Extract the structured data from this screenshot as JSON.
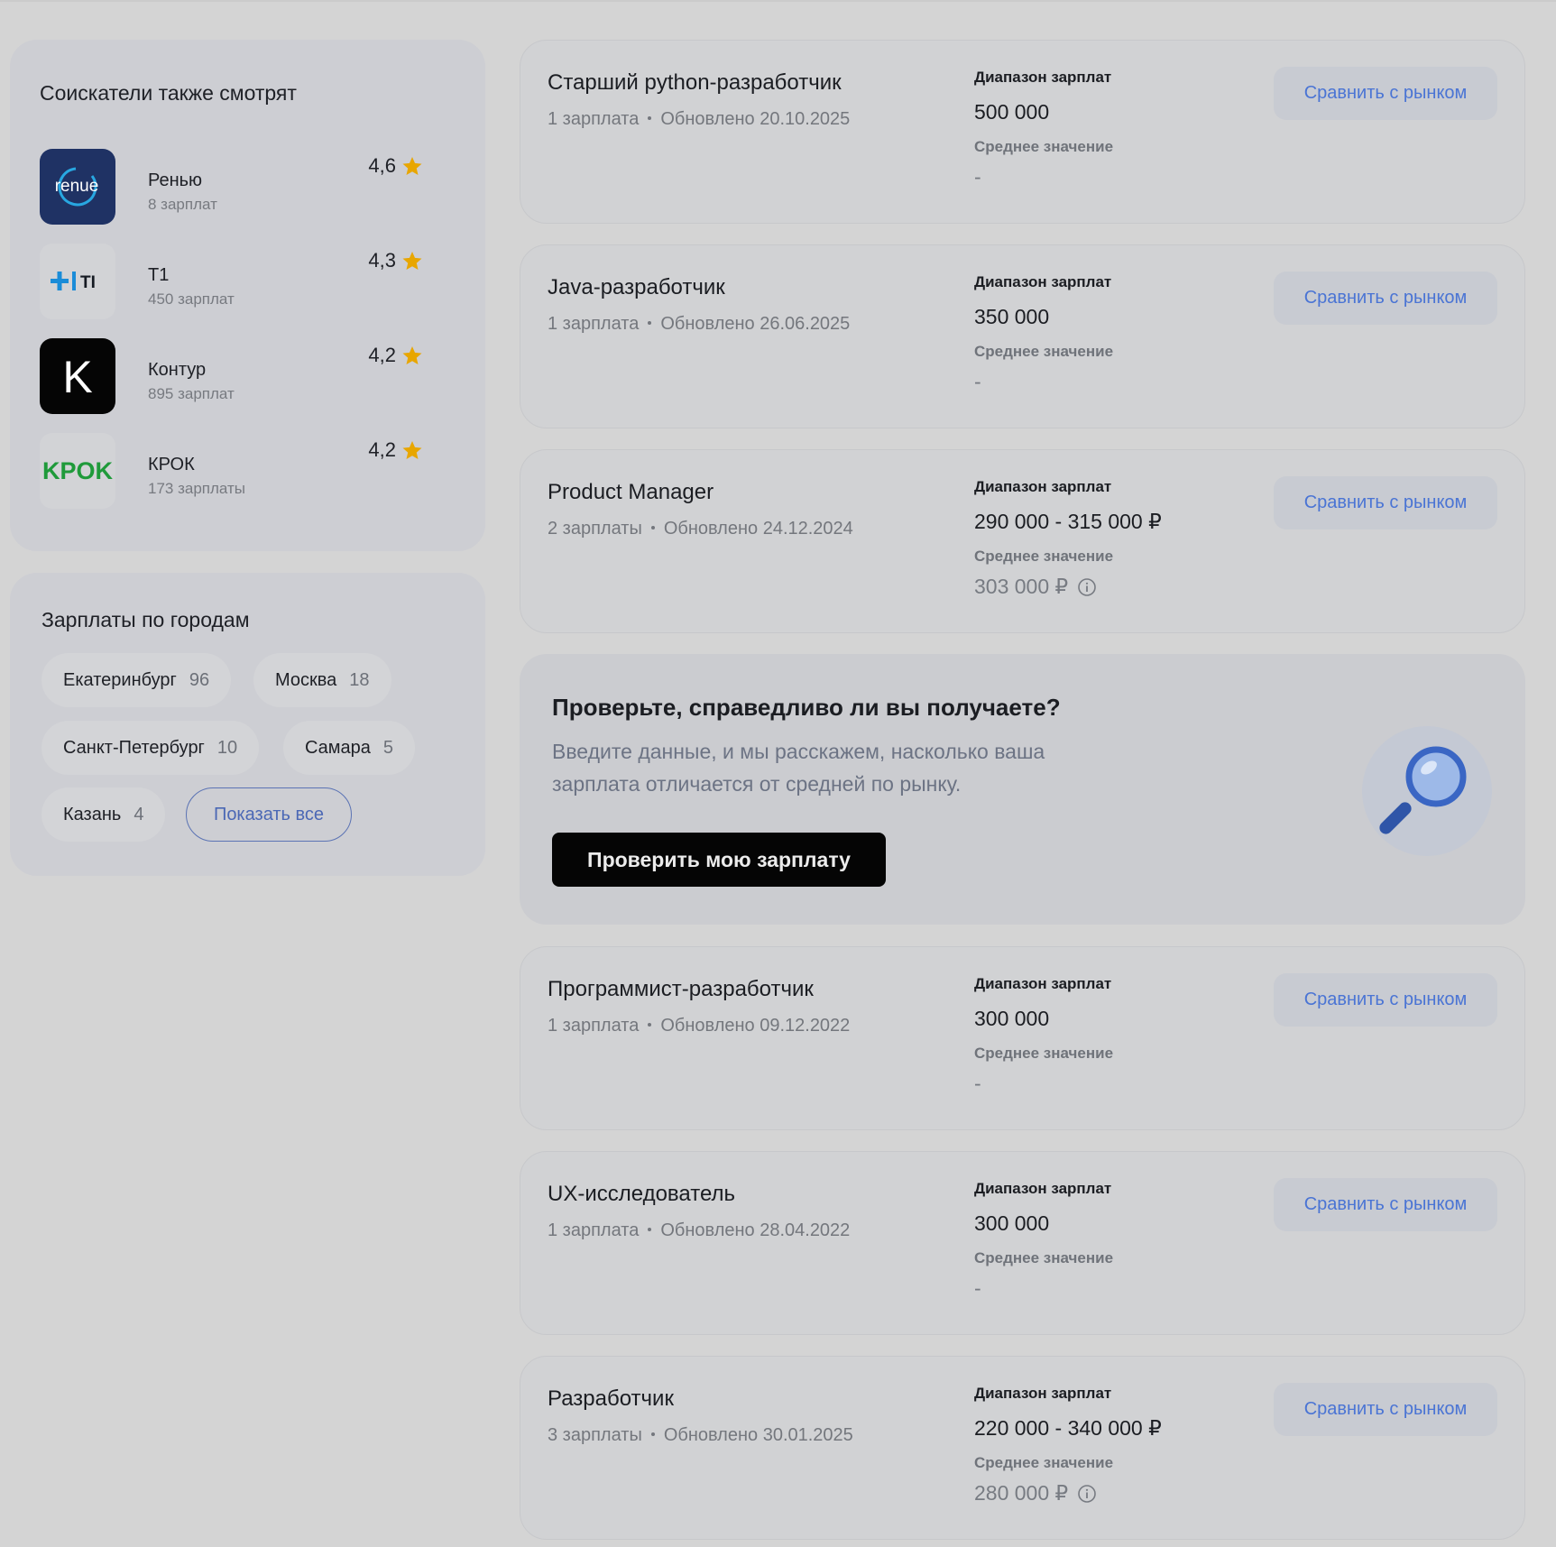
{
  "sidebar": {
    "companies_title": "Соискатели также смотрят",
    "companies": [
      {
        "name": "Ренью",
        "count": "8 зарплат",
        "rating": "4,6",
        "logo_text": "renue"
      },
      {
        "name": "Т1",
        "count": "450 зарплат",
        "rating": "4,3",
        "logo_text": "TI"
      },
      {
        "name": "Контур",
        "count": "895 зарплат",
        "rating": "4,2",
        "logo_text": "K"
      },
      {
        "name": "КРОК",
        "count": "173 зарплаты",
        "rating": "4,2",
        "logo_text": "KPOK"
      }
    ],
    "cities_title": "Зарплаты по городам",
    "cities": [
      {
        "name": "Екатеринбург",
        "count": "96"
      },
      {
        "name": "Москва",
        "count": "18"
      },
      {
        "name": "Санкт-Петербург",
        "count": "10"
      },
      {
        "name": "Самара",
        "count": "5"
      },
      {
        "name": "Казань",
        "count": "4"
      }
    ],
    "show_all": "Показать все"
  },
  "labels": {
    "range": "Диапазон зарплат",
    "average": "Среднее значение",
    "compare": "Сравнить с рынком"
  },
  "jobs": [
    {
      "title": "Старший python-разработчик",
      "salaries": "1 зарплата",
      "updated": "Обновлено 20.10.2025",
      "range": "500 000",
      "average": "-"
    },
    {
      "title": "Java-разработчик",
      "salaries": "1 зарплата",
      "updated": "Обновлено 26.06.2025",
      "range": "350 000",
      "average": "-"
    },
    {
      "title": "Product Manager",
      "salaries": "2 зарплаты",
      "updated": "Обновлено 24.12.2024",
      "range": "290 000 - 315 000 ₽",
      "average": "303 000 ₽"
    },
    {
      "title": "Программист-разработчик",
      "salaries": "1 зарплата",
      "updated": "Обновлено 09.12.2022",
      "range": "300 000",
      "average": "-"
    },
    {
      "title": "UX-исследователь",
      "salaries": "1 зарплата",
      "updated": "Обновлено 28.04.2022",
      "range": "300 000",
      "average": "-"
    },
    {
      "title": "Разработчик",
      "salaries": "3 зарплаты",
      "updated": "Обновлено 30.01.2025",
      "range": "220 000 - 340 000 ₽",
      "average": "280 000 ₽"
    }
  ],
  "promo": {
    "title": "Проверьте, справедливо ли вы получаете?",
    "text": "Введите данные, и мы расскажем, насколько ваша зарплата отличается от средней по рынку.",
    "button": "Проверить мою зарплату"
  },
  "colors": {
    "accent_blue": "#4a74d4",
    "star": "#e8a600",
    "krok_green": "#1f9a3a",
    "t1_blue": "#1a8cd8"
  }
}
